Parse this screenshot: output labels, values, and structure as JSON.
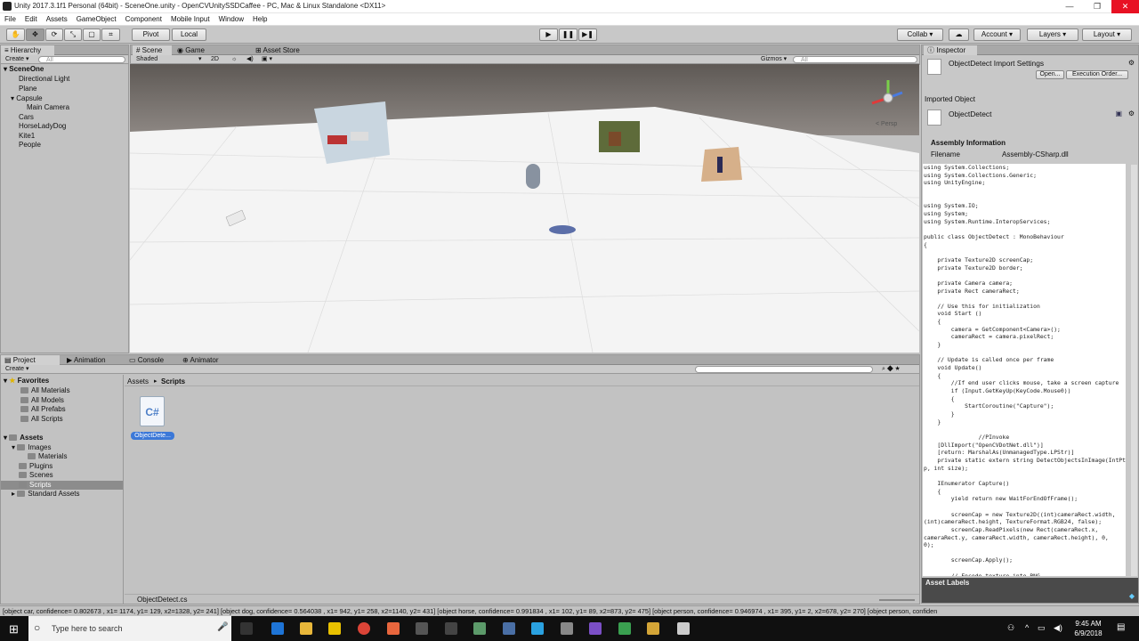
{
  "window": {
    "title": "Unity 2017.3.1f1 Personal (64bit) - SceneOne.unity - OpenCVUnitySSDCaffee - PC, Mac & Linux Standalone <DX11>",
    "minimize": "—",
    "restore": "❐",
    "close": "✕"
  },
  "menu": [
    "File",
    "Edit",
    "Assets",
    "GameObject",
    "Component",
    "Mobile Input",
    "Window",
    "Help"
  ],
  "toolbar": {
    "pivot": "Pivot",
    "local": "Local",
    "collab": "Collab ▾",
    "account": "Account ▾",
    "layers": "Layers ▾",
    "layout": "Layout ▾",
    "play": "▶",
    "pause": "❚❚",
    "step": "▶❚"
  },
  "hierarchy": {
    "tab": "Hierarchy",
    "create": "Create ▾",
    "search": "All",
    "scene": "SceneOne",
    "items": [
      "Directional Light",
      "Plane",
      "Capsule",
      "Main Camera",
      "Cars",
      "HorseLadyDog",
      "Kite1",
      "People"
    ]
  },
  "scene": {
    "tab_scene": "Scene",
    "tab_game": "Game",
    "tab_store": "Asset Store",
    "shaded": "Shaded",
    "mode2d": "2D",
    "gizmos": "Gizmos ▾",
    "search": "All",
    "persp": "< Persp"
  },
  "inspector": {
    "tab": "Inspector",
    "title": "ObjectDetect Import Settings",
    "open": "Open...",
    "exec_order": "Execution Order...",
    "imported_object": "Imported Object",
    "object_name": "ObjectDetect",
    "assembly_info": "Assembly Information",
    "filename_label": "Filename",
    "filename_value": "Assembly-CSharp.dll",
    "asset_labels": "Asset Labels",
    "code": "using System.Collections;\nusing System.Collections.Generic;\nusing UnityEngine;\n\n\nusing System.IO;\nusing System;\nusing System.Runtime.InteropServices;\n\npublic class ObjectDetect : MonoBehaviour\n{\n\n    private Texture2D screenCap;\n    private Texture2D border;\n\n    private Camera camera;\n    private Rect cameraRect;\n\n    // Use this for initialization\n    void Start ()\n    {\n        camera = GetComponent<Camera>();\n        cameraRect = camera.pixelRect;\n    }\n\n    // Update is called once per frame\n    void Update()\n    {\n        //If end user clicks mouse, take a screen capture\n        if (Input.GetKeyUp(KeyCode.Mouse0))\n        {\n            StartCoroutine(\"Capture\");\n        }\n    }\n\n                //PInvoke\n    [DllImport(\"OpenCVDotNet.dll\")]\n    [return: MarshalAs(UnmanagedType.LPStr)]\n    private static extern string DetectObjectsInImage(IntPtr\np, int size);\n\n    IEnumerator Capture()\n    {\n        yield return new WaitForEndOfFrame();\n\n        screenCap = new Texture2D((int)cameraRect.width,\n(int)cameraRect.height, TextureFormat.RGB24, false);\n        screenCap.ReadPixels(new Rect(cameraRect.x,\ncameraRect.y, cameraRect.width, cameraRect.height), 0,\n0);\n\n        screenCap.Apply();\n\n        // Encode texture into PNG\n        byte[] imageData = screenCap.EncodeToJPG();"
  },
  "project": {
    "tab_project": "Project",
    "tab_animation": "Animation",
    "tab_console": "Console",
    "tab_animator": "Animator",
    "create": "Create ▾",
    "favorites": "Favorites",
    "fav_items": [
      "All Materials",
      "All Models",
      "All Prefabs",
      "All Scripts"
    ],
    "assets": "Assets",
    "asset_items": [
      "Images",
      "Materials",
      "Plugins",
      "Scenes",
      "Scripts",
      "Standard Assets"
    ],
    "crumb_assets": "Assets",
    "crumb_sep": "▸",
    "crumb_scripts": "Scripts",
    "file_label": "ObjectDete...",
    "file_icon_text": "C#",
    "footer_file": "ObjectDetect.cs"
  },
  "status": "[object car, confidence= 0.802673 , x1= 1174, y1= 129, x2=1328, y2= 241] [object dog, confidence= 0.564038 , x1= 942, y1= 258, x2=1140, y2= 431] [object horse, confidence= 0.991834 , x1= 102, y1= 89, x2=873, y2= 475] [object person, confidence= 0.946974 , x1= 395, y1= 2, x2=678, y2= 270] [object person, confiden",
  "taskbar": {
    "search": "Type here to search",
    "time": "9:45 AM",
    "date": "6/9/2018"
  },
  "colors": {
    "selection": "#3b78d8",
    "accent_close": "#e81123",
    "sky": "#7c7571",
    "plane": "#f3f3f3"
  }
}
